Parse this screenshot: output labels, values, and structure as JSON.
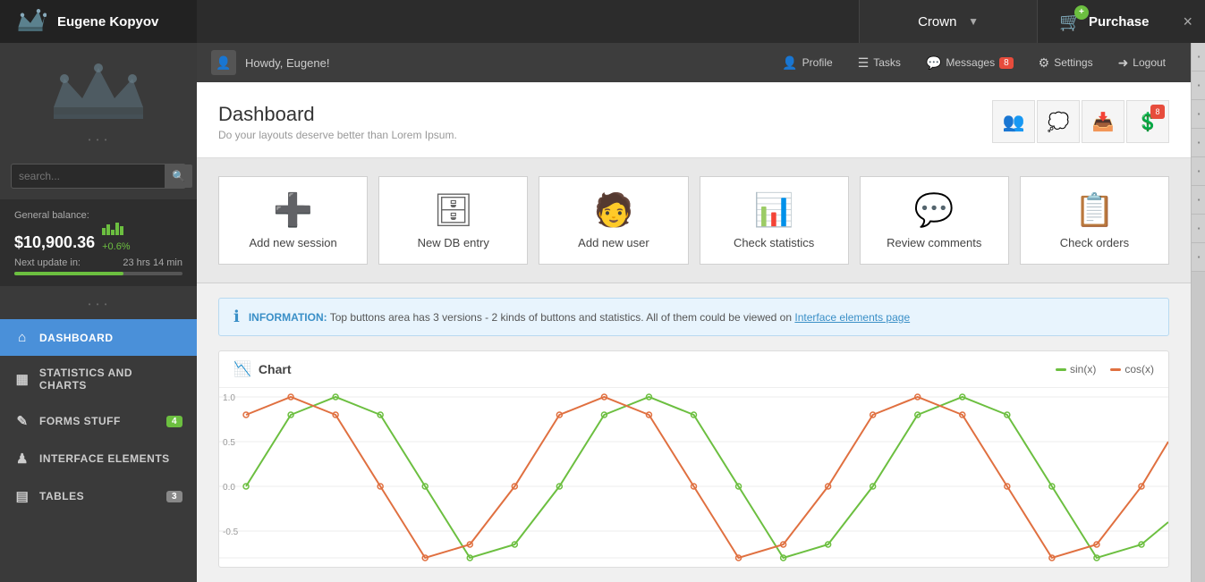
{
  "topbar": {
    "user_name": "Eugene Kopyov",
    "crown_label": "Crown",
    "purchase_label": "Purchase",
    "close_label": "×"
  },
  "sidebar": {
    "search_placeholder": "search...",
    "balance": {
      "label": "General balance:",
      "amount": "$10,900.36",
      "change": "+0.6%",
      "next_update_label": "Next update in:",
      "next_update_value": "23 hrs  14 min"
    },
    "nav_items": [
      {
        "id": "dashboard",
        "label": "Dashboard",
        "icon": "⌂",
        "active": true
      },
      {
        "id": "statistics",
        "label": "Statistics and Charts",
        "icon": "▦"
      },
      {
        "id": "forms",
        "label": "Forms Stuff",
        "icon": "✎",
        "badge": "4"
      },
      {
        "id": "interface",
        "label": "Interface Elements",
        "icon": "♟"
      },
      {
        "id": "tables",
        "label": "Tables",
        "icon": "▤",
        "badge": "3"
      }
    ]
  },
  "top_nav": {
    "howdy": "Howdy, Eugene!",
    "profile": "Profile",
    "tasks": "Tasks",
    "messages": "Messages",
    "messages_badge": "8",
    "settings": "Settings",
    "logout": "Logout"
  },
  "dashboard": {
    "title": "Dashboard",
    "subtitle": "Do your layouts deserve better than Lorem Ipsum.",
    "icon_badge": "8"
  },
  "actions": [
    {
      "id": "add-session",
      "label": "Add new session",
      "icon": "➕",
      "icon_color": "#6cbf40"
    },
    {
      "id": "new-db",
      "label": "New DB entry",
      "icon": "🗄",
      "icon_color": "#888"
    },
    {
      "id": "add-user",
      "label": "Add new user",
      "icon": "👤",
      "icon_color": "#f0a830"
    },
    {
      "id": "check-stats",
      "label": "Check statistics",
      "icon": "📊",
      "icon_color": "#4a90d9"
    },
    {
      "id": "review-comments",
      "label": "Review comments",
      "icon": "💬",
      "icon_color": "#4a90d9"
    },
    {
      "id": "check-orders",
      "label": "Check orders",
      "icon": "📋",
      "icon_color": "#c8841a"
    }
  ],
  "info_banner": {
    "label": "INFORMATION:",
    "text": "Top buttons area has 3 versions - 2 kinds of buttons and statistics. All of them could be viewed on ",
    "link_text": "Interface elements page"
  },
  "chart": {
    "title": "Chart",
    "legend": [
      {
        "id": "sin",
        "label": "sin(x)",
        "color": "#6cbf40"
      },
      {
        "id": "cos",
        "label": "cos(x)",
        "color": "#e07040"
      }
    ],
    "y_labels": [
      "1.0",
      "0.5",
      "0.0",
      "-0.5"
    ]
  }
}
